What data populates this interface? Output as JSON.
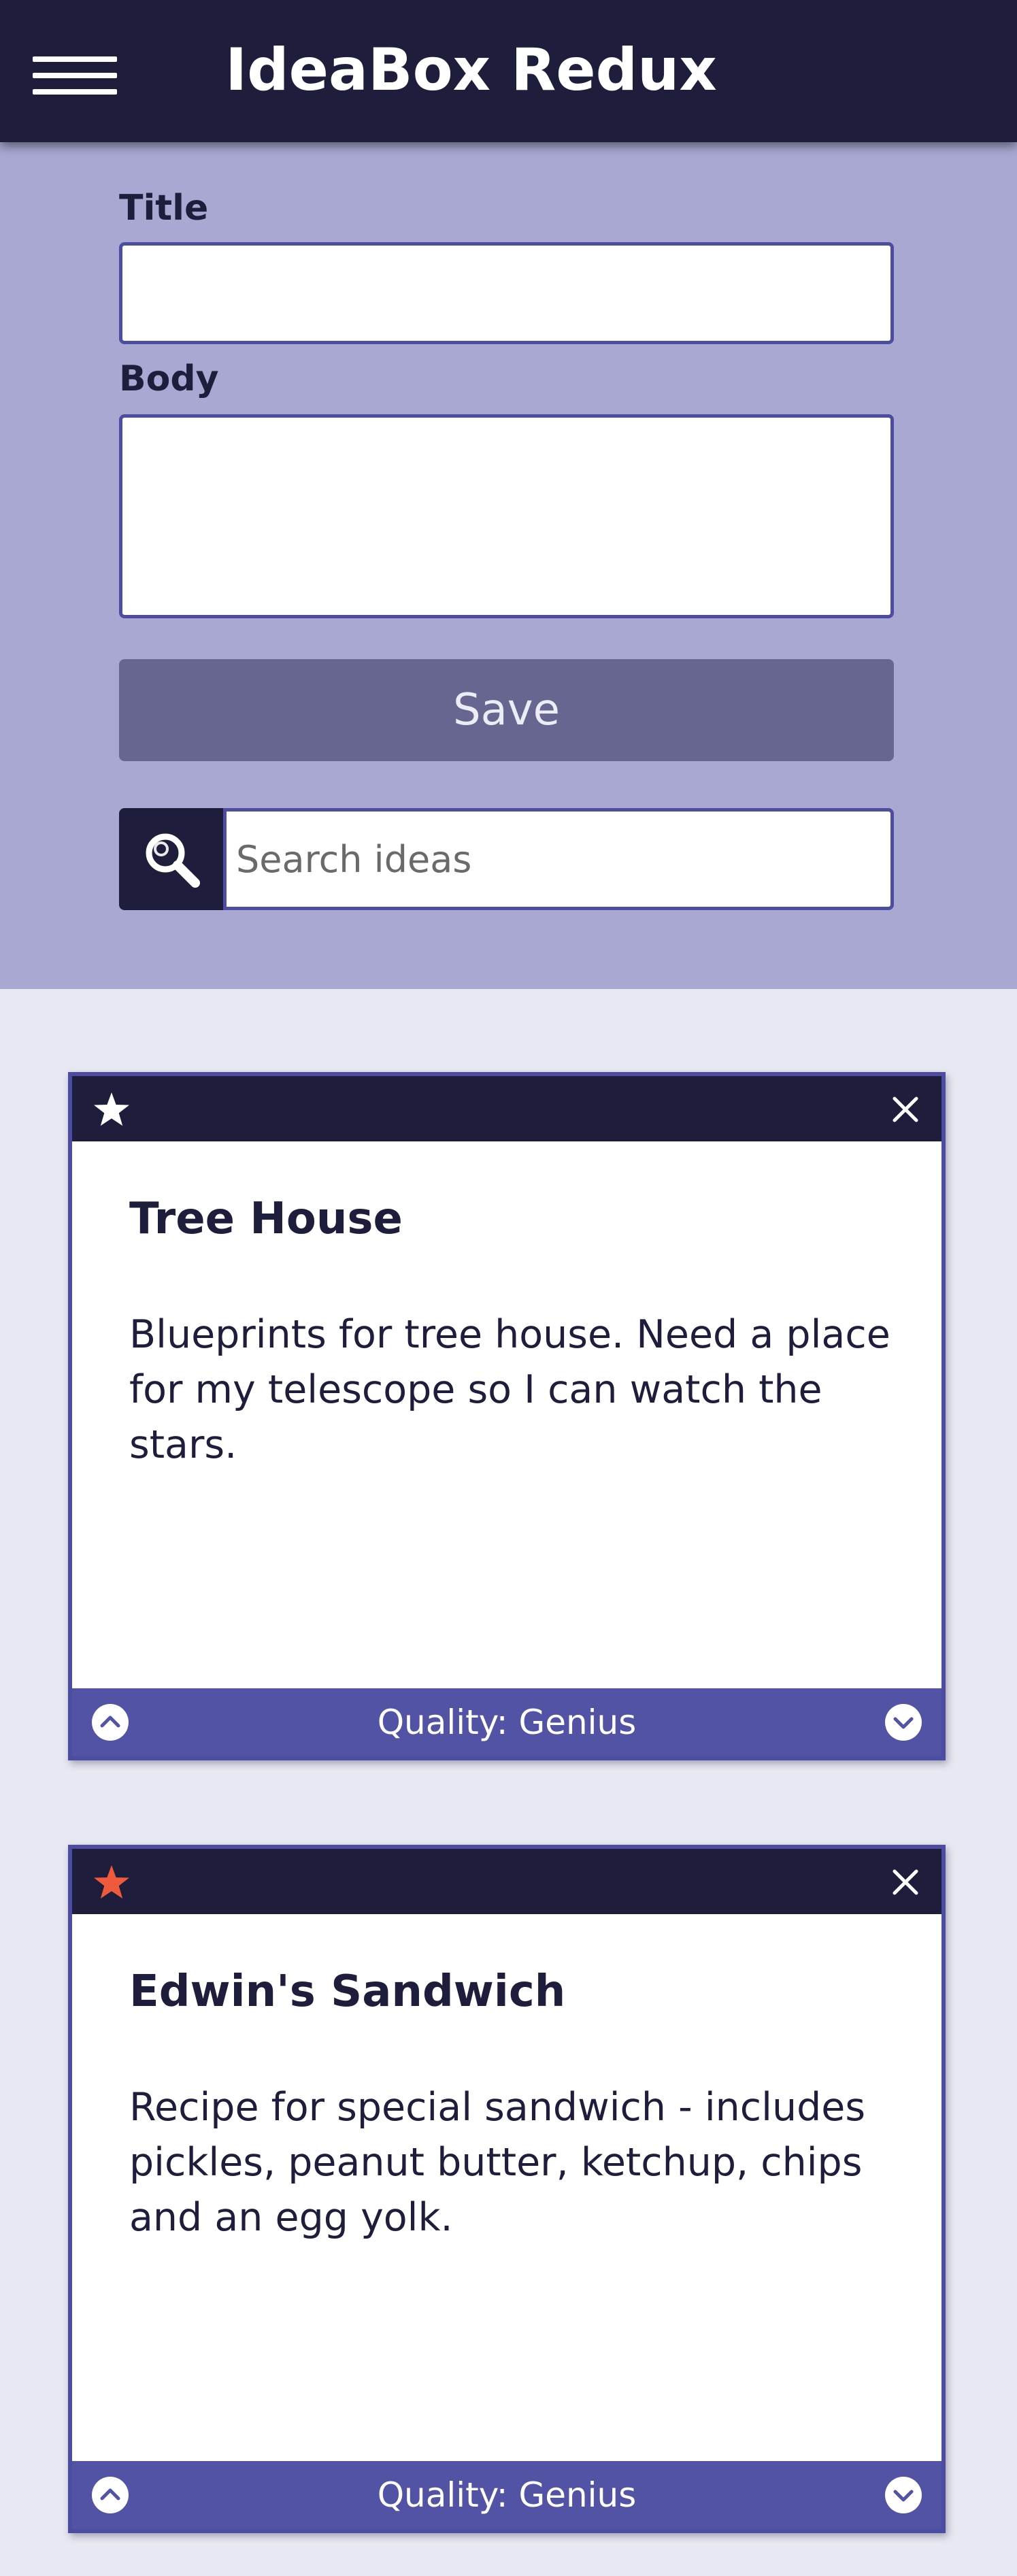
{
  "app": {
    "title": "IdeaBox Redux"
  },
  "header": {
    "menu_icon": "hamburger-menu-icon"
  },
  "form": {
    "title_label": "Title",
    "title_value": "",
    "body_label": "Body",
    "body_value": "",
    "save_label": "Save"
  },
  "search": {
    "icon": "search-icon",
    "placeholder": "Search ideas",
    "value": ""
  },
  "ideas": [
    {
      "title": "Tree House",
      "body": "Blueprints for tree house. Need a place for my telescope so I can watch the stars.",
      "quality": "Quality: Genius",
      "starred": false,
      "star_color": "#ffffff"
    },
    {
      "title": "Edwin's Sandwich",
      "body": "Recipe for special sandwich - includes pickles, peanut butter, ketchup, chips and an egg yolk.",
      "quality": "Quality: Genius",
      "starred": true,
      "star_color": "#f05a3c"
    }
  ],
  "colors": {
    "header_bg": "#1e1e3c",
    "form_bg": "#a8a8d2",
    "page_bg": "#e8e8f2",
    "accent_border": "#4c4ca0",
    "save_button_bg": "#666690",
    "card_footer_bg": "#5353a6",
    "starred": "#f05a3c"
  }
}
